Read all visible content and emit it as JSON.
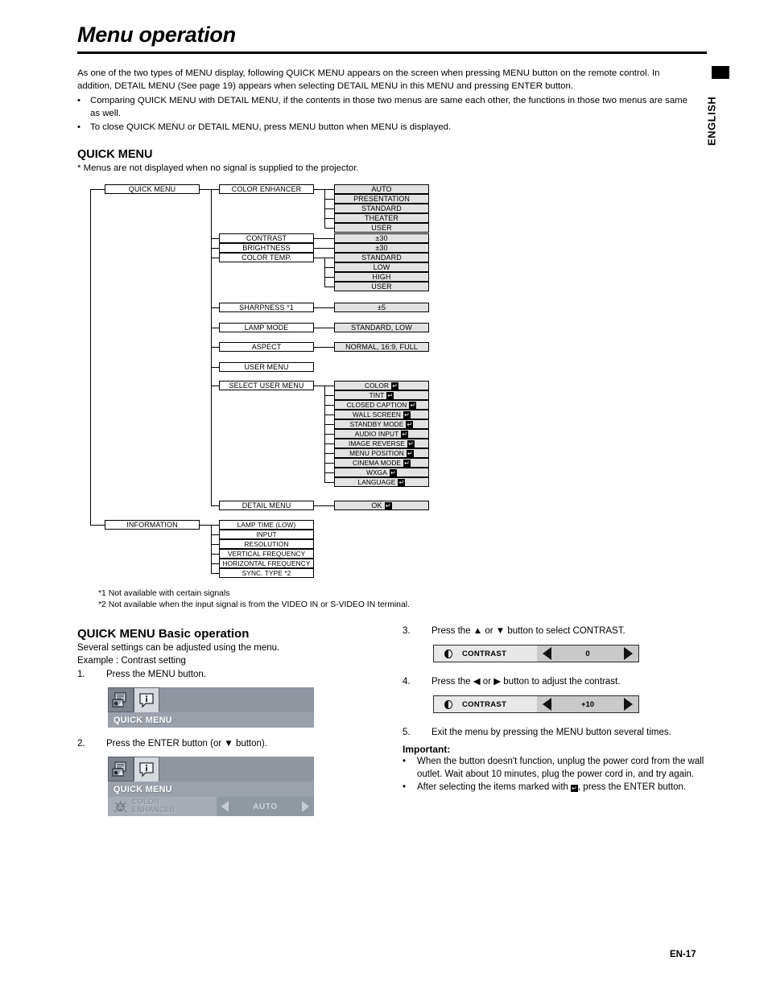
{
  "page": {
    "title": "Menu operation",
    "language_tab": "ENGLISH",
    "page_number": "EN-17"
  },
  "intro": {
    "paragraph": "As one of the two types of MENU display, following QUICK MENU appears on the screen when pressing MENU button on the remote control. In addition, DETAIL MENU (See page 19) appears when selecting DETAIL MENU in this MENU and pressing ENTER button.",
    "bullets": [
      "Comparing QUICK MENU with DETAIL MENU, if the contents in those two menus are same each other, the functions in those two menus are same as well.",
      "To close QUICK MENU or DETAIL MENU, press MENU button when MENU is displayed."
    ]
  },
  "quick_menu_section": {
    "heading": "QUICK MENU",
    "note": "* Menus are not displayed when no signal is supplied to the projector."
  },
  "diagram": {
    "root": "QUICK MENU",
    "information_root": "INFORMATION",
    "level2": [
      "COLOR ENHANCER",
      "CONTRAST",
      "BRIGHTNESS",
      "COLOR TEMP.",
      "SHARPNESS *1",
      "LAMP MODE",
      "ASPECT",
      "USER MENU",
      "SELECT USER MENU",
      "DETAIL MENU"
    ],
    "color_enhancer_values": [
      "AUTO",
      "PRESENTATION",
      "STANDARD",
      "THEATER",
      "USER"
    ],
    "contrast_value": "±30",
    "brightness_value": "±30",
    "color_temp_values": [
      "STANDARD",
      "LOW",
      "HIGH",
      "USER"
    ],
    "sharpness_value": "±5",
    "lamp_mode_value": "STANDARD, LOW",
    "aspect_value": "NORMAL, 16:9, FULL",
    "select_user_menu_values": [
      "COLOR",
      "TINT",
      "CLOSED CAPTION",
      "WALL SCREEN",
      "STANDBY MODE",
      "AUDIO INPUT",
      "IMAGE REVERSE",
      "MENU POSITION",
      "CINEMA MODE",
      "WXGA",
      "LANGUAGE"
    ],
    "detail_menu_value": "OK",
    "information_items": [
      "LAMP TIME (LOW)",
      "INPUT",
      "RESOLUTION",
      "VERTICAL FREQUENCY",
      "HORIZONTAL FREQUENCY",
      "SYNC. TYPE *2"
    ]
  },
  "footnotes": {
    "f1": "*1 Not available with certain signals",
    "f2": "*2 Not available when the input signal is from the VIDEO IN or S-VIDEO IN terminal."
  },
  "basic_operation": {
    "heading": "QUICK MENU Basic operation",
    "lead": "Several settings can be adjusted using the menu.",
    "example": "Example : Contrast setting",
    "steps": [
      {
        "num": "1.",
        "text": "Press the MENU button."
      },
      {
        "num": "2.",
        "text": "Press the ENTER button (or ▼ button)."
      },
      {
        "num": "3.",
        "text": "Press the ▲ or ▼ button to select CONTRAST."
      },
      {
        "num": "4.",
        "text": "Press the ◀ or ▶ button to adjust the contrast."
      },
      {
        "num": "5.",
        "text": "Exit the menu by pressing the MENU button several times."
      }
    ]
  },
  "osd_mock_1": {
    "title": "QUICK MENU"
  },
  "osd_mock_2": {
    "title": "QUICK MENU",
    "row_label_line1": "COLOR",
    "row_label_line2": "ENHANCER",
    "row_value": "AUTO"
  },
  "contrast_bar_1": {
    "label": "CONTRAST",
    "value": "0"
  },
  "contrast_bar_2": {
    "label": "CONTRAST",
    "value": "+10"
  },
  "important": {
    "heading": "Important:",
    "bullets": [
      "When the button doesn't function, unplug the power cord from the wall outlet. Wait about 10 minutes, plug the power cord in, and try again.",
      "After selecting the items marked with"
    ],
    "bullet2_tail": ", press the ENTER button."
  },
  "colors": {
    "shade": "#e2e2e2",
    "osd_title_bar": "#9aa1ab",
    "osd_row": "#a6adb6"
  }
}
